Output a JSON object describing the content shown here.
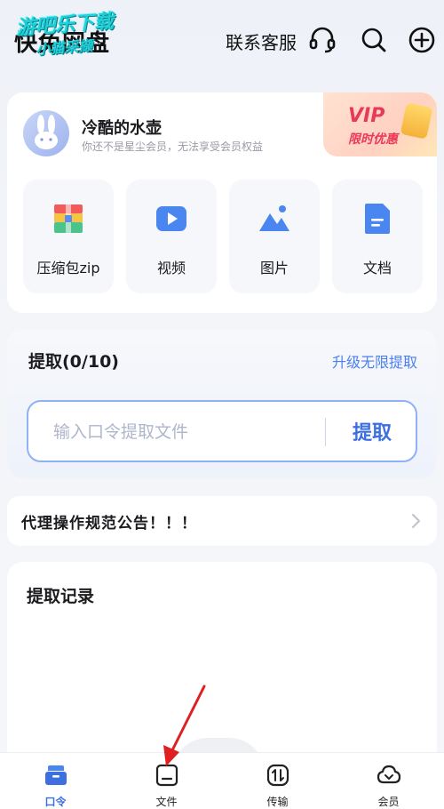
{
  "header": {
    "app_title": "快兔网盘",
    "watermark_line1": "游吧乐下载",
    "watermark_line2": "小猫采撷",
    "support_label": "联系客服",
    "icons": [
      "headset-icon",
      "search-icon",
      "add-circle-icon"
    ]
  },
  "user": {
    "name": "冷酷的水壶",
    "membership_note": "你还不是星尘会员，无法享受会员权益",
    "vip_badge_title": "VIP",
    "vip_badge_sub": "限时优惠"
  },
  "categories": [
    {
      "label": "压缩包zip",
      "icon": "zip-archive-icon"
    },
    {
      "label": "视频",
      "icon": "video-icon"
    },
    {
      "label": "图片",
      "icon": "image-icon"
    },
    {
      "label": "文档",
      "icon": "document-icon"
    }
  ],
  "extract": {
    "title": "提取(0/10)",
    "upgrade_link": "升级无限提取",
    "input_placeholder": "输入口令提取文件",
    "input_value": "",
    "button_label": "提取"
  },
  "notice": {
    "text": "代理操作规范公告！！！"
  },
  "history": {
    "title": "提取记录"
  },
  "tabbar": {
    "active_index": 0,
    "tabs": [
      {
        "label": "口令",
        "icon": "inbox-icon"
      },
      {
        "label": "文件",
        "icon": "folder-icon"
      },
      {
        "label": "传输",
        "icon": "transfer-icon"
      },
      {
        "label": "会员",
        "icon": "cloud-icon"
      }
    ]
  },
  "colors": {
    "accent": "#3d6fe0",
    "link": "#4a7ff0",
    "vip": "#e8395a",
    "annotation_arrow": "#e02020"
  }
}
